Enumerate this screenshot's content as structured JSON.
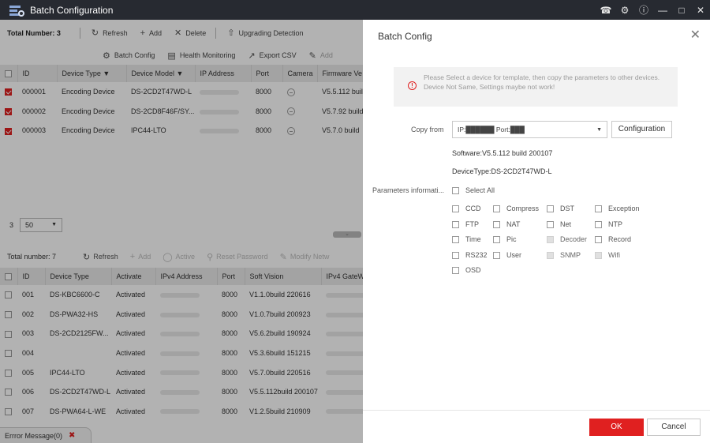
{
  "window": {
    "title": "Batch Configuration"
  },
  "top": {
    "total_label": "Total Number: 3",
    "toolbar": {
      "refresh": "Refresh",
      "add": "Add",
      "delete": "Delete",
      "upgrade": "Upgrading Detection",
      "batch_config": "Batch Config",
      "health": "Health Monitoring",
      "export": "Export CSV",
      "add2": "Add"
    },
    "columns": [
      "ID",
      "Device Type",
      "Device Model",
      "IP Address",
      "Port",
      "Camera",
      "Firmware Ve"
    ],
    "rows": [
      {
        "id": "000001",
        "type": "Encoding Device",
        "model": "DS-2CD2T47WD-L",
        "port": "8000",
        "firmware": "V5.5.112 build"
      },
      {
        "id": "000002",
        "type": "Encoding Device",
        "model": "DS-2CD8F46F/SY...",
        "port": "8000",
        "firmware": "V5.7.92 build"
      },
      {
        "id": "000003",
        "type": "Encoding Device",
        "model": "IPC44-LTO",
        "port": "8000",
        "firmware": "V5.7.0 build"
      }
    ],
    "pager": {
      "count": "3",
      "page_size": "50"
    }
  },
  "bottom": {
    "total_label": "Total number: 7",
    "toolbar": {
      "refresh": "Refresh",
      "add": "Add",
      "active": "Active",
      "reset": "Reset Password",
      "modify": "Modify Netw"
    },
    "columns": [
      "ID",
      "Device Type",
      "Activate",
      "IPv4 Address",
      "Port",
      "Soft Vision",
      "IPv4 GateW"
    ],
    "rows": [
      {
        "id": "001",
        "type": "DS-KBC6600-C",
        "activate": "Activated",
        "port": "8000",
        "soft": "V1.1.0build 220616"
      },
      {
        "id": "002",
        "type": "DS-PWA32-HS",
        "activate": "Activated",
        "port": "8000",
        "soft": "V1.0.7build 200923"
      },
      {
        "id": "003",
        "type": "DS-2CD2125FW...",
        "activate": "Activated",
        "port": "8000",
        "soft": "V5.6.2build 190924"
      },
      {
        "id": "004",
        "type": "",
        "activate": "Activated",
        "port": "8000",
        "soft": "V5.3.6build 151215"
      },
      {
        "id": "005",
        "type": "IPC44-LTO",
        "activate": "Activated",
        "port": "8000",
        "soft": "V5.7.0build 220516"
      },
      {
        "id": "006",
        "type": "DS-2CD2T47WD-L",
        "activate": "Activated",
        "port": "8000",
        "soft": "V5.5.112build 200107"
      },
      {
        "id": "007",
        "type": "DS-PWA64-L-WE",
        "activate": "Activated",
        "port": "8000",
        "soft": "V1.2.5build 210909"
      }
    ]
  },
  "error_bar": {
    "label": "Errror Message(0)"
  },
  "dialog": {
    "title": "Batch Config",
    "notice_line1": "Please Select a device for template, then copy the parameters to other devices.",
    "notice_line2": "Device Not Same, Settings maybe not work!",
    "copy_from_label": "Copy from",
    "copy_from_value": "IP:██████  Port:███",
    "configuration_button": "Configuration",
    "software": "Software:V5.5.112 build 200107",
    "device_type": "DeviceType:DS-2CD2T47WD-L",
    "params_label": "Parameters informati...",
    "select_all": "Select All",
    "params": [
      "CCD",
      "Compress",
      "DST",
      "Exception",
      "FTP",
      "NAT",
      "Net",
      "NTP",
      "Time",
      "Pic",
      "Decoder",
      "Record",
      "RS232",
      "User",
      "SNMP",
      "Wifi",
      "OSD"
    ],
    "ok": "OK",
    "cancel": "Cancel"
  }
}
